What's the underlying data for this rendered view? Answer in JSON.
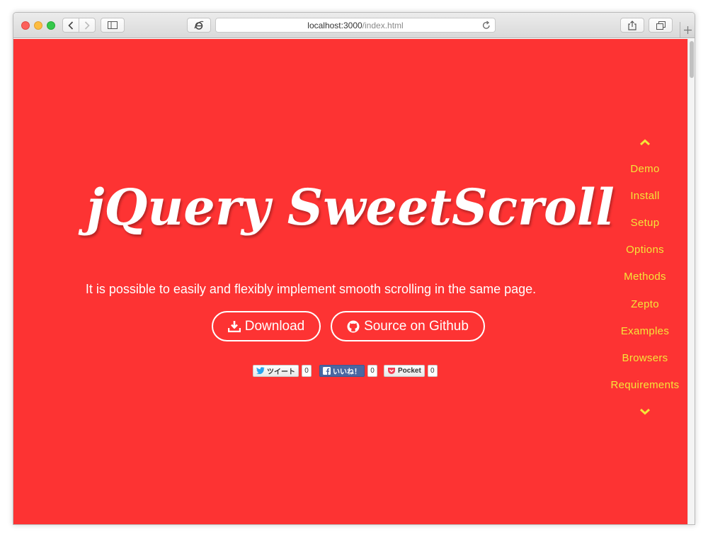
{
  "browser": {
    "url_host": "localhost:3000",
    "url_path": "/index.html"
  },
  "hero": {
    "title": "jQuery SweetScroll",
    "subtitle": "It is possible to easily and flexibly implement smooth scrolling in the same page.",
    "download_label": "Download",
    "github_label": "Source on Github"
  },
  "social": {
    "tweet_label": "ツイート",
    "tweet_count": "0",
    "like_label": "いいね！",
    "like_count": "0",
    "pocket_label": "Pocket",
    "pocket_count": "0"
  },
  "side_nav": {
    "items": [
      "Demo",
      "Install",
      "Setup",
      "Options",
      "Methods",
      "Zepto",
      "Examples",
      "Browsers",
      "Requirements"
    ]
  },
  "colors": {
    "background": "#fd3333",
    "nav_text": "#f4e639",
    "hero_text": "#ffffff"
  }
}
